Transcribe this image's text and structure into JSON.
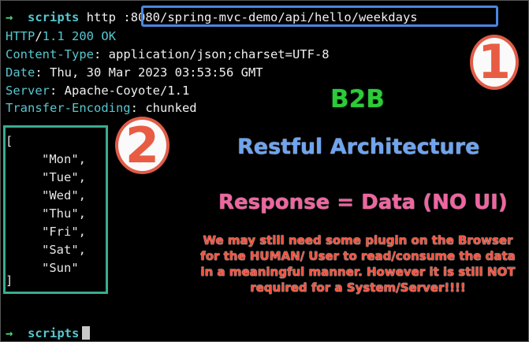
{
  "command": {
    "prompt_symbol": "→",
    "directory": "scripts",
    "program": "http",
    "url": ":8080/spring-mvc-demo/api/hello/weekdays"
  },
  "response": {
    "status_proto": "HTTP",
    "status_slash": "/",
    "status_version": "1.1",
    "status_code": "200",
    "status_text": "OK",
    "headers": [
      {
        "name": "Content-Type",
        "value": "application/json;charset=UTF-8"
      },
      {
        "name": "Date",
        "value": "Thu, 30 Mar 2023 03:53:56 GMT"
      },
      {
        "name": "Server",
        "value": "Apache-Coyote/1.1"
      },
      {
        "name": "Transfer-Encoding",
        "value": "chunked"
      }
    ],
    "json_open": "[",
    "json_items": [
      "\"Mon\",",
      "\"Tue\",",
      "\"Wed\",",
      "\"Thu\",",
      "\"Fri\",",
      "\"Sat\",",
      "\"Sun\""
    ],
    "json_close": "]"
  },
  "annotations": {
    "badge_1": "1",
    "badge_2": "2",
    "b2b": "B2B",
    "restful": "Restful Architecture",
    "response_eq": "Response = Data (NO UI)",
    "note": "We may still need some plugin on the Browser for the HUMAN/ User to read/consume the data in a meaningful manner. However it is still NOT required for a System/Server!!!!"
  },
  "next_prompt": {
    "prompt_symbol": "→",
    "directory": "scripts"
  },
  "colors": {
    "background": "#000000",
    "cyan": "#57c7cf",
    "prompt_arrow": "#4fd17a",
    "url_box": "#4a86e0",
    "json_box": "#3aab92",
    "badge": "#e05c47",
    "b2b": "#2ecb38",
    "restful": "#6ea4f0",
    "response": "#f064a0",
    "note": "#f2523e"
  }
}
